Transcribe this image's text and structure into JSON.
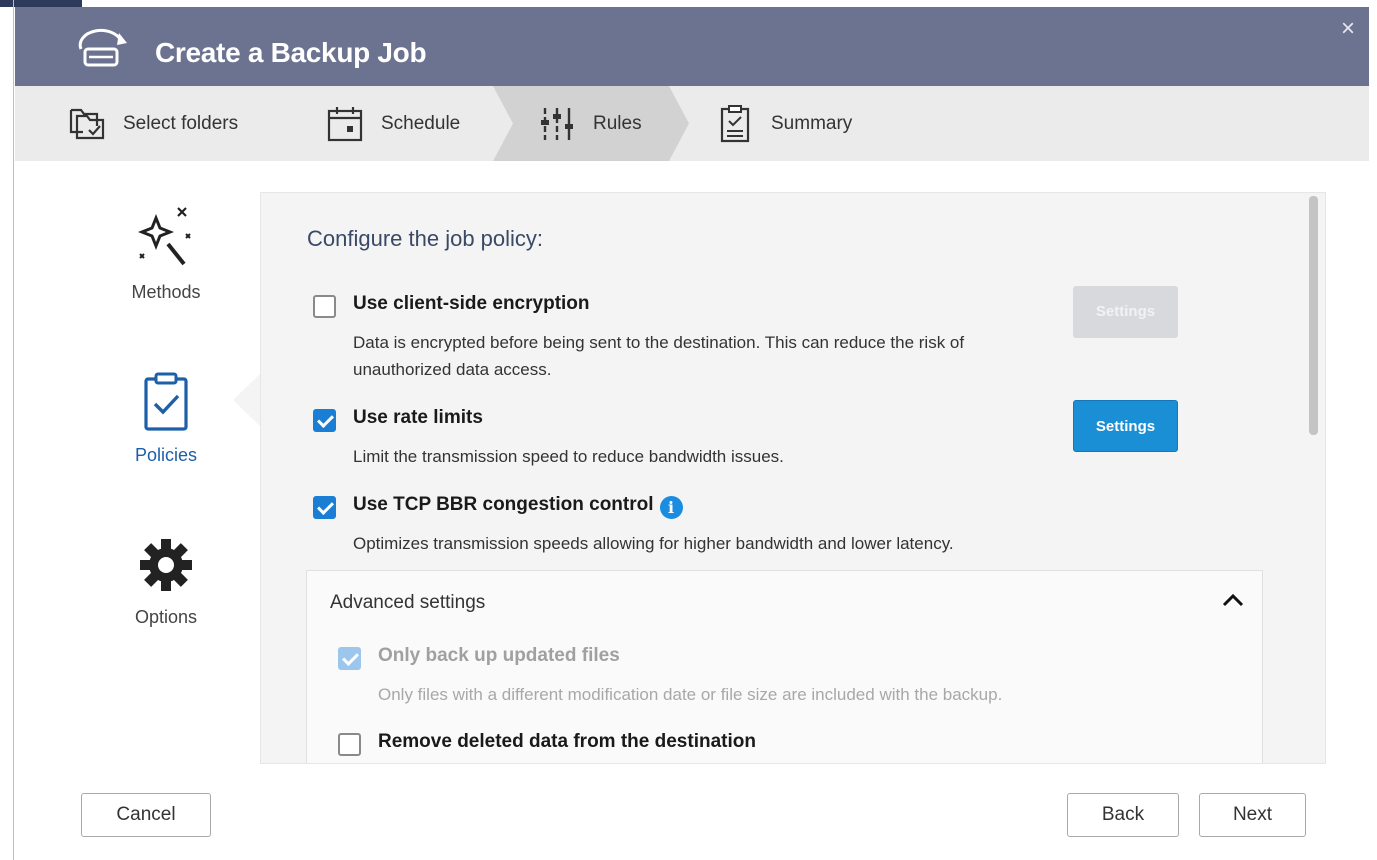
{
  "dialog": {
    "title": "Create a Backup Job",
    "close_symbol": "×"
  },
  "steps": [
    {
      "label": "Select folders",
      "icon": "folder-check-icon"
    },
    {
      "label": "Schedule",
      "icon": "calendar-icon"
    },
    {
      "label": "Rules",
      "icon": "sliders-icon",
      "active": true
    },
    {
      "label": "Summary",
      "icon": "clipboard-list-icon"
    }
  ],
  "sidebar": {
    "items": [
      {
        "label": "Methods",
        "icon": "magic-wand-icon"
      },
      {
        "label": "Policies",
        "icon": "clipboard-check-icon",
        "active": true
      },
      {
        "label": "Options",
        "icon": "gear-icon"
      }
    ]
  },
  "panel": {
    "heading": "Configure the job policy:",
    "options": [
      {
        "label": "Use client-side encryption",
        "desc": "Data is encrypted before being sent to the destination. This can reduce the risk of unauthorized data access.",
        "checked": false,
        "settings_label": "Settings",
        "settings_enabled": false
      },
      {
        "label": "Use rate limits",
        "desc": "Limit the transmission speed to reduce bandwidth issues.",
        "checked": true,
        "settings_label": "Settings",
        "settings_enabled": true
      },
      {
        "label": "Use TCP BBR congestion control",
        "desc": "Optimizes transmission speeds allowing for higher bandwidth and lower latency.",
        "checked": true,
        "info_symbol": "i"
      }
    ],
    "advanced": {
      "title": "Advanced settings",
      "expanded": true,
      "options": [
        {
          "label": "Only back up updated files",
          "desc": "Only files with a different modification date or file size are included with the backup.",
          "checked": true,
          "disabled": true
        },
        {
          "label": "Remove deleted data from the destination",
          "checked": false
        }
      ]
    }
  },
  "footer": {
    "cancel_label": "Cancel",
    "back_label": "Back",
    "next_label": "Next"
  },
  "colors": {
    "titlebar": "#6c7390",
    "accent": "#1a8fd6",
    "active_sidebar": "#1d5fa8"
  }
}
